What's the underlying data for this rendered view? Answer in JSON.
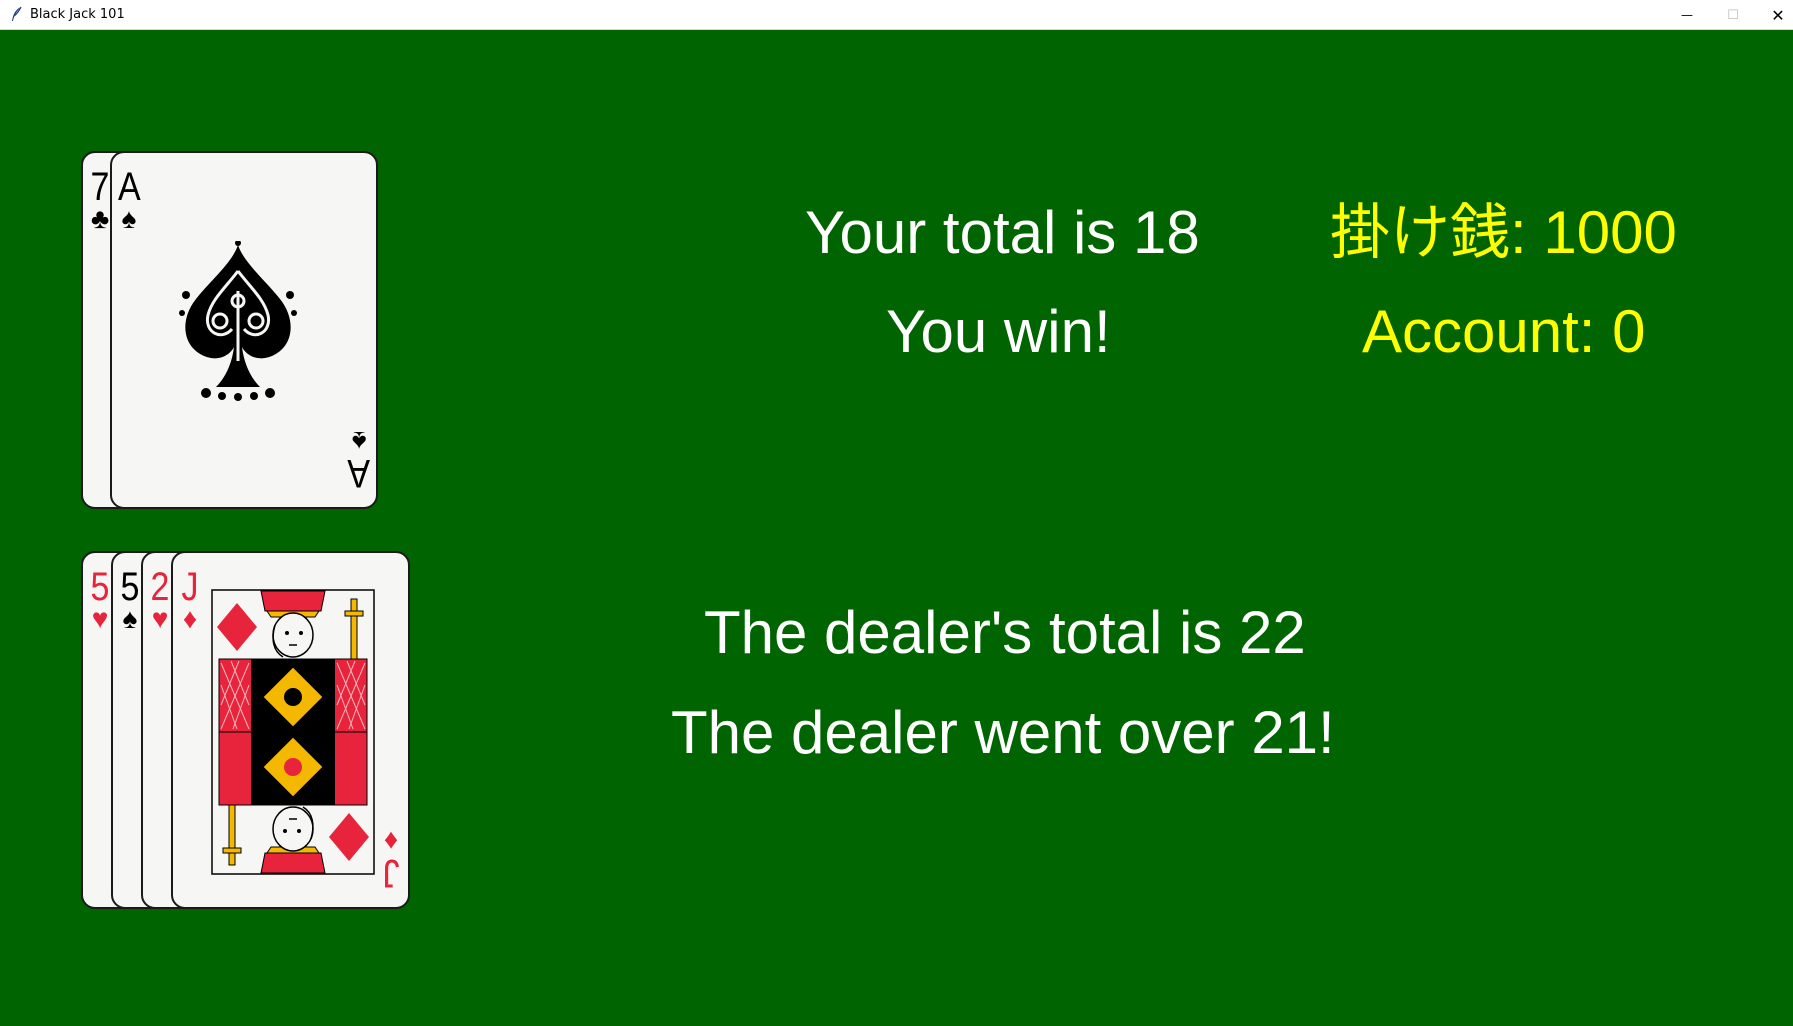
{
  "window": {
    "title": "Black Jack 101",
    "minimize_glyph": "—",
    "maximize_glyph": "☐",
    "close_glyph": "✕"
  },
  "player": {
    "cards": [
      {
        "rank": "7",
        "suit": "♣",
        "color": "black"
      },
      {
        "rank": "A",
        "suit": "♠",
        "color": "black"
      }
    ],
    "total_text": "Your total is 18",
    "result_text": "You win!"
  },
  "dealer": {
    "cards": [
      {
        "rank": "5",
        "suit": "♥",
        "color": "red"
      },
      {
        "rank": "5",
        "suit": "♠",
        "color": "black"
      },
      {
        "rank": "2",
        "suit": "♥",
        "color": "red"
      },
      {
        "rank": "J",
        "suit": "♦",
        "color": "red"
      }
    ],
    "total_text": "The dealer's total is 22",
    "result_text": "The dealer went over 21!"
  },
  "bet": {
    "bet_text": "掛け銭: 1000",
    "account_text": "Account: 0"
  },
  "colors": {
    "felt": "#006400",
    "message_text": "#ffffff",
    "money_text": "#ffff00",
    "red_suit": "#e8243c"
  }
}
